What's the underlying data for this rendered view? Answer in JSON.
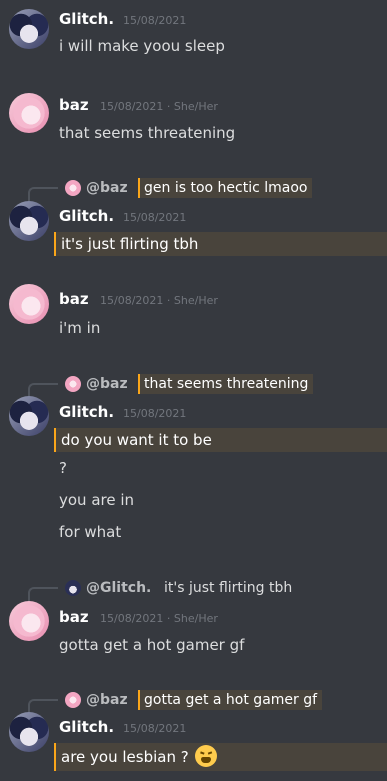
{
  "messages": [
    {
      "author": "Glitch.",
      "timestamp": "15/08/2021",
      "pronouns": "",
      "lines": [
        "i will make yoou sleep"
      ]
    },
    {
      "author": "baz",
      "timestamp": "15/08/2021",
      "pronouns": "She/Her",
      "lines": [
        "that seems threatening"
      ]
    },
    {
      "reply_to": "@baz",
      "reply_quote": "gen is too hectic lmaoo",
      "author": "Glitch.",
      "timestamp": "15/08/2021",
      "pronouns": "",
      "lines": [
        "it's just flirting tbh"
      ]
    },
    {
      "author": "baz",
      "timestamp": "15/08/2021",
      "pronouns": "She/Her",
      "lines": [
        "i'm in"
      ]
    },
    {
      "reply_to": "@baz",
      "reply_quote": "that seems threatening",
      "author": "Glitch.",
      "timestamp": "15/08/2021",
      "pronouns": "",
      "lines": [
        "do you want it to be",
        "?",
        "you are in",
        "for what"
      ]
    },
    {
      "reply_to": "@Glitch.",
      "reply_quote": "it's just flirting tbh",
      "author": "baz",
      "timestamp": "15/08/2021",
      "pronouns": "She/Her",
      "lines": [
        "gotta get a hot gamer gf"
      ]
    },
    {
      "reply_to": "@baz",
      "reply_quote": "gotta get a hot gamer gf",
      "author": "Glitch.",
      "timestamp": "15/08/2021",
      "pronouns": "",
      "lines": [
        "are you lesbian ?"
      ],
      "emoji": "weary-face-icon"
    }
  ],
  "meta_separator": "·",
  "colors": {
    "background": "#36393f",
    "mention_highlight": "#49443c",
    "mention_bar": "#faa61a",
    "timestamp": "#72767d"
  }
}
